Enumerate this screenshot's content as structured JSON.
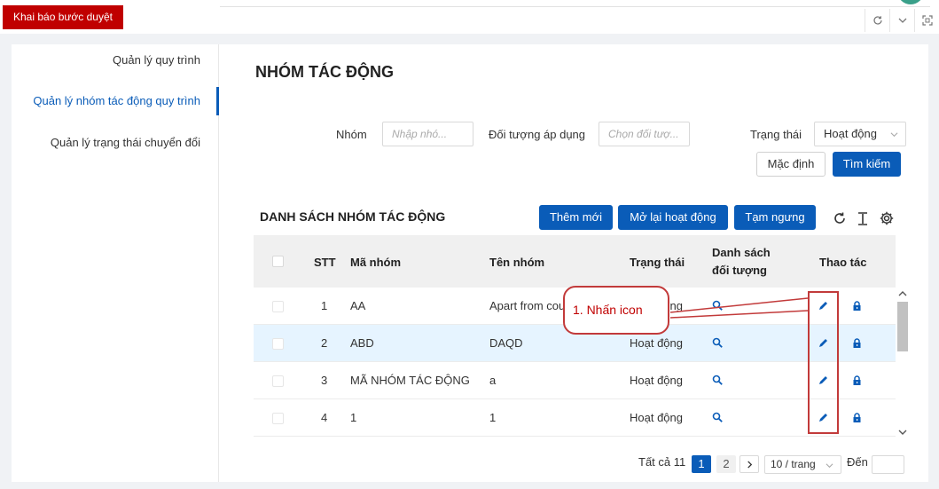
{
  "top": {
    "breadcrumb": "Khai báo bước duyệt"
  },
  "sidebar": {
    "items": [
      {
        "label": "Quản lý quy trình"
      },
      {
        "label": "Quản lý nhóm tác động quy trình"
      },
      {
        "label": "Quản lý trạng thái chuyển đổi"
      }
    ]
  },
  "page": {
    "title": "NHÓM TÁC ĐỘNG"
  },
  "filters": {
    "group_label": "Nhóm",
    "group_placeholder": "Nhập nhó...",
    "object_label": "Đối tượng áp dụng",
    "object_placeholder": "Chọn đối tượ...",
    "status_label": "Trạng thái",
    "status_value": "Hoạt động",
    "default_button": "Mặc định",
    "search_button": "Tìm kiếm"
  },
  "list": {
    "title": "DANH SÁCH NHÓM TÁC ĐỘNG",
    "add_button": "Thêm mới",
    "reopen_button": "Mở lại hoạt động",
    "suspend_button": "Tạm ngưng"
  },
  "table": {
    "headers": {
      "stt": "STT",
      "code": "Mã nhóm",
      "name": "Tên nhóm",
      "status": "Trạng thái",
      "objects_line1": "Danh sách",
      "objects_line2": "đối tượng",
      "actions": "Thao tác"
    },
    "rows": [
      {
        "stt": "1",
        "code": "AA",
        "name": "Apart from cou",
        "status": "Hoạt động"
      },
      {
        "stt": "2",
        "code": "ABD",
        "name": "DAQD",
        "status": "Hoạt động"
      },
      {
        "stt": "3",
        "code": "MÃ NHÓM TÁC ĐỘNG",
        "name": "a",
        "status": "Hoạt động"
      },
      {
        "stt": "4",
        "code": "1",
        "name": "1",
        "status": "Hoạt động"
      }
    ]
  },
  "pager": {
    "total": "Tất cả 11",
    "pages": [
      "1",
      "2"
    ],
    "page_size": "10 / trang",
    "goto_label": "Đến"
  },
  "annotation": {
    "text": "1. Nhấn icon"
  }
}
